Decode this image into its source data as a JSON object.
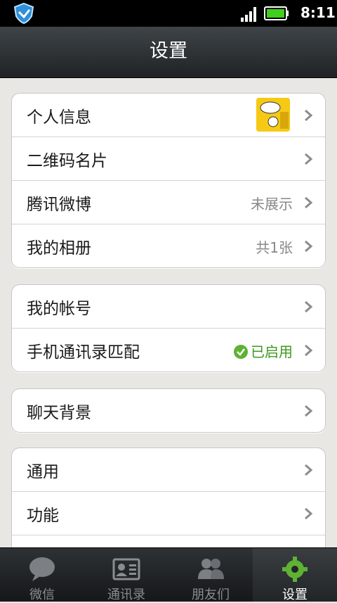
{
  "status_bar": {
    "time": "8:11"
  },
  "header": {
    "title": "设置"
  },
  "groups": [
    {
      "rows": [
        {
          "label": "个人信息",
          "value": ""
        },
        {
          "label": "二维码名片",
          "value": ""
        },
        {
          "label": "腾讯微博",
          "value": "未展示"
        },
        {
          "label": "我的相册",
          "value": "共1张"
        }
      ]
    },
    {
      "rows": [
        {
          "label": "我的帐号",
          "value": ""
        },
        {
          "label": "手机通讯录匹配",
          "value": "已启用"
        }
      ]
    },
    {
      "rows": [
        {
          "label": "聊天背景",
          "value": ""
        }
      ]
    },
    {
      "rows": [
        {
          "label": "通用",
          "value": ""
        },
        {
          "label": "功能",
          "value": ""
        }
      ]
    }
  ],
  "tabs": [
    {
      "label": "微信",
      "icon": "chat-bubble-icon"
    },
    {
      "label": "通讯录",
      "icon": "contact-card-icon"
    },
    {
      "label": "朋友们",
      "icon": "friends-icon"
    },
    {
      "label": "设置",
      "icon": "gear-icon",
      "active": true
    }
  ],
  "colors": {
    "enabled_green": "#3c9a1e",
    "accent_green": "#5fb233"
  }
}
